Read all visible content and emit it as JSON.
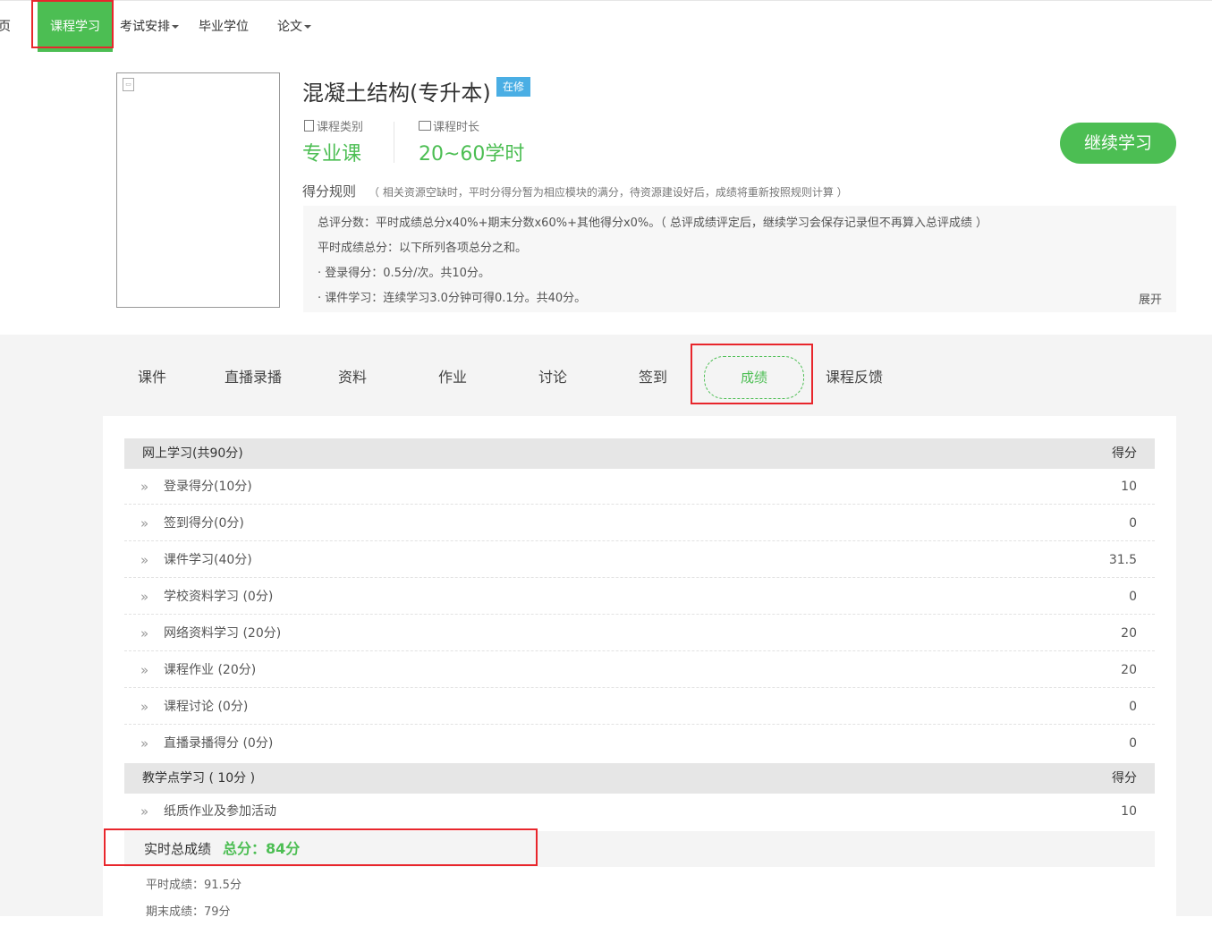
{
  "nav": {
    "home": "首页",
    "course_study": "课程学习",
    "exam": "考试安排",
    "degree": "毕业学位",
    "thesis": "论文"
  },
  "course": {
    "title": "混凝土结构(专升本)",
    "status": "在修",
    "category_label": "课程类别",
    "category_value": "专业课",
    "duration_label": "课程时长",
    "duration_value": "20~60学时",
    "continue_label": "继续学习"
  },
  "rules": {
    "title": "得分规则",
    "note": "（ 相关资源空缺时，平时分得分暂为相应模块的满分，待资源建设好后，成绩将重新按照规则计算 ）",
    "lines": [
      "总评分数：平时成绩总分x40%+期末分数x60%+其他得分x0%。（ 总评成绩评定后，继续学习会保存记录但不再算入总评成绩 ）",
      "平时成绩总分：以下所列各项总分之和。",
      "· 登录得分：0.5分/次。共10分。",
      "· 课件学习：连续学习3.0分钟可得0.1分。共40分。"
    ],
    "expand": "展开"
  },
  "tabs": [
    "课件",
    "直播录播",
    "资料",
    "作业",
    "讨论",
    "签到",
    "成绩",
    "课程反馈"
  ],
  "grades": {
    "online": {
      "title": "网上学习(共90分)",
      "score_header": "得分",
      "rows": [
        {
          "label": "登录得分(10分)",
          "score": "10"
        },
        {
          "label": "签到得分(0分)",
          "score": "0"
        },
        {
          "label": "课件学习(40分)",
          "score": "31.5"
        },
        {
          "label": "学校资料学习 (0分)",
          "score": "0"
        },
        {
          "label": "网络资料学习 (20分)",
          "score": "20"
        },
        {
          "label": "课程作业 (20分)",
          "score": "20"
        },
        {
          "label": "课程讨论 (0分)",
          "score": "0"
        },
        {
          "label": "直播录播得分 (0分)",
          "score": "0"
        }
      ]
    },
    "teaching": {
      "title": "教学点学习 ( 10分 )",
      "score_header": "得分",
      "rows": [
        {
          "label": "纸质作业及参加活动",
          "score": "10"
        }
      ]
    },
    "total_label": "实时总成绩",
    "total_value": "总分：84分",
    "regular": "平时成绩：91.5分",
    "final": "期末成绩：79分"
  },
  "colors": {
    "brand_green": "#4cbe53",
    "badge_blue": "#4aaee4",
    "highlight_red": "#e8262c"
  }
}
